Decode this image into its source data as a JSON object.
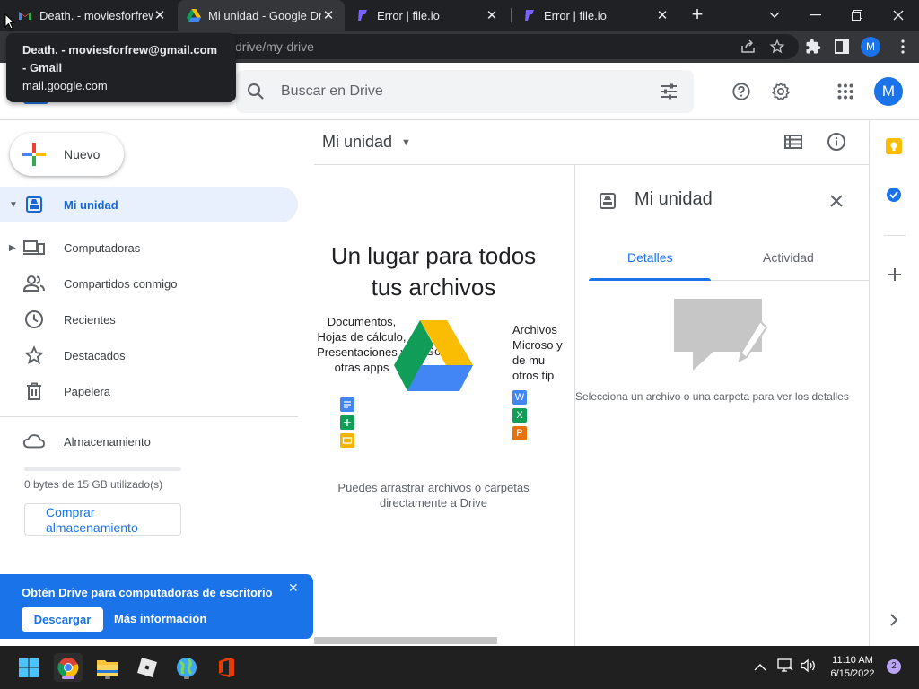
{
  "browser": {
    "tabs": [
      {
        "title": "Death. - moviesforfrew",
        "icon": "gmail-icon",
        "active": false
      },
      {
        "title": "Mi unidad - Google Dri",
        "icon": "drive-icon",
        "active": true
      },
      {
        "title": "Error | file.io",
        "icon": "fileio-icon",
        "active": false
      },
      {
        "title": "Error | file.io",
        "icon": "fileio-icon",
        "active": false
      }
    ],
    "url": "drive/my-drive",
    "profile_initial": "M",
    "tooltip": {
      "line1": "Death. - moviesforfrew@gmail.com",
      "line2": "- Gmail",
      "line3": "mail.google.com"
    }
  },
  "drive": {
    "search_placeholder": "Buscar en Drive",
    "avatar_initial": "M",
    "new_button": "Nuevo",
    "nav": [
      {
        "label": "Mi unidad",
        "icon": "my-drive-icon",
        "active": true
      },
      {
        "label": "Computadoras",
        "icon": "computers-icon"
      },
      {
        "label": "Compartidos conmigo",
        "icon": "shared-icon"
      },
      {
        "label": "Recientes",
        "icon": "clock-icon"
      },
      {
        "label": "Destacados",
        "icon": "star-icon"
      },
      {
        "label": "Papelera",
        "icon": "trash-icon"
      }
    ],
    "storage": {
      "label": "Almacenamiento",
      "used_text": "0 bytes de 15 GB utilizado(s)",
      "used_fraction": 0,
      "buy_label": "Comprar almacenamiento"
    },
    "promo": {
      "title": "Obtén Drive para computadoras de escritorio",
      "download": "Descargar",
      "more_info": "Más información"
    },
    "main": {
      "title": "Mi unidad",
      "empty_title": "Un lugar para todos tus archivos",
      "left_text": "Documentos, Hojas de cálculo, Presentaciones y otras apps",
      "right_text": "Archivos Microso y de mu otros tip",
      "overlay_fragment": "Goog e",
      "drag_hint": "Puedes arrastrar archivos o carpetas directamente a Drive"
    },
    "details": {
      "title": "Mi unidad",
      "tab_details": "Detalles",
      "tab_activity": "Actividad",
      "hint": "Selecciona un archivo o una carpeta para ver los detalles"
    }
  },
  "taskbar": {
    "time": "11:10 AM",
    "date": "6/15/2022",
    "notifications": "2"
  },
  "colors": {
    "accent": "#1a73e8",
    "chrome_dark": "#202124",
    "chrome_mid": "#35363a",
    "active_nav_bg": "#e8f0fe"
  }
}
